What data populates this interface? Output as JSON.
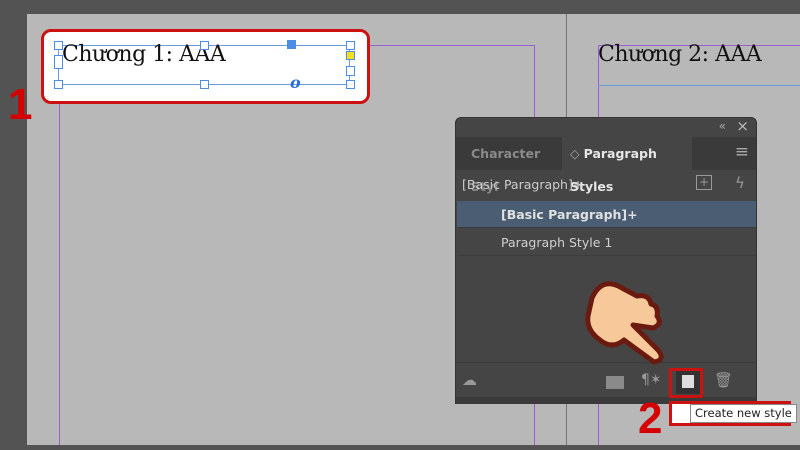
{
  "canvas": {
    "left_frame_text": "Chương 1: AAA",
    "right_frame_text": "Chương 2: AAA",
    "overflow_marker": "o"
  },
  "annotations": {
    "step1": "1",
    "step2": "2"
  },
  "panel": {
    "collapse_icon": "«",
    "close_icon": "×",
    "tabs": [
      {
        "label": "Character Styl"
      },
      {
        "label": "Paragraph Styles",
        "arrows": "◇"
      }
    ],
    "menu_icon": "≡",
    "current_style": "[Basic Paragraph]+",
    "styles": [
      {
        "label": "[Basic Paragraph]+",
        "selected": true
      },
      {
        "label": "Paragraph Style 1",
        "selected": false
      }
    ],
    "footer_icons": [
      "load-from-cloud-icon",
      "new-group-icon",
      "clear-overrides-icon",
      "create-new-style-icon",
      "delete-icon"
    ]
  },
  "tooltip": {
    "text": "Create new style"
  },
  "colors": {
    "highlight": "#cc1111",
    "selection": "#4a5d73"
  }
}
